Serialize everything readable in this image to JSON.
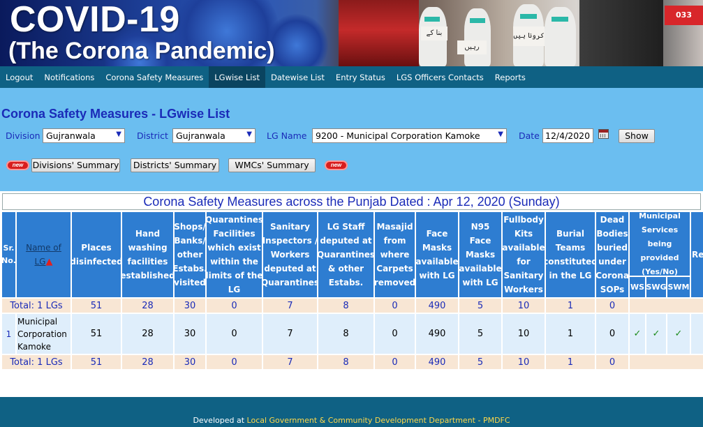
{
  "banner": {
    "title": "COVID-19",
    "subtitle": "(The Corona Pandemic)",
    "sign1": "بنا کے",
    "sign2": "رہیں",
    "sign3": "کرونا ہیں",
    "tag": "033"
  },
  "nav": {
    "items": [
      {
        "label": "Logout"
      },
      {
        "label": "Notifications"
      },
      {
        "label": "Corona Safety Measures"
      },
      {
        "label": "LGwise List"
      },
      {
        "label": "Datewise List"
      },
      {
        "label": "Entry Status"
      },
      {
        "label": "LGS Officers Contacts"
      },
      {
        "label": "Reports"
      }
    ],
    "active_index": 3
  },
  "page_title": "Corona Safety Measures - LGwise List",
  "filters": {
    "division_label": "Division",
    "division_value": "Gujranwala",
    "district_label": "District",
    "district_value": "Gujranwala",
    "lg_label": "LG Name",
    "lg_value": "9200 - Municipal Corporation Kamoke",
    "date_label": "Date",
    "date_value": "12/4/2020",
    "show_button": "Show"
  },
  "summary_buttons": {
    "new_badge": "new",
    "divisions": "Divisions' Summary",
    "districts": "Districts' Summary",
    "wmcs": "WMCs' Summary"
  },
  "table": {
    "caption": "Corona Safety Measures across the Punjab Dated : Apr 12, 2020 (Sunday)",
    "headers": {
      "sr": "Sr. No.",
      "name": "Name of LG",
      "places": "Places disinfected",
      "hand": "Hand washing facilities established",
      "shops": "Shops/ Banks/ other Estabs. visited",
      "quarantine": "Quarantines Facilities which exist within the limits of the LG",
      "sanitary": "Sanitary Inspectors / Workers deputed at Quarantines",
      "lgstaff": "LG Staff deputed at Quarantines & other Estabs.",
      "masajid": "Masajid from where Carpets removed",
      "face": "Face Masks available with LG",
      "n95": "N95 Face Masks available with LG",
      "fullbody": "Fullbody Kits available for Sanitary Workers",
      "burial": "Burial Teams constituted in the LG",
      "dead": "Dead Bodies buried under Corona SOPs",
      "municipal": "Municipal Services being provided (Yes/No)",
      "ws": "WS",
      "swg": "SWG",
      "swm": "SWM",
      "re": "Re"
    },
    "total_label": "Total: 1 LGs",
    "totals": [
      "51",
      "28",
      "30",
      "0",
      "7",
      "8",
      "0",
      "490",
      "5",
      "10",
      "1",
      "0"
    ],
    "rows": [
      {
        "sr": "1",
        "name": "Municipal Corporation Kamoke",
        "values": [
          "51",
          "28",
          "30",
          "0",
          "7",
          "8",
          "0",
          "490",
          "5",
          "10",
          "1",
          "0"
        ],
        "ws": "✓",
        "swg": "✓",
        "swm": "✓"
      }
    ]
  },
  "footer": {
    "prefix": "Developed at ",
    "link": "Local Government & Community Development Department - PMDFC"
  }
}
